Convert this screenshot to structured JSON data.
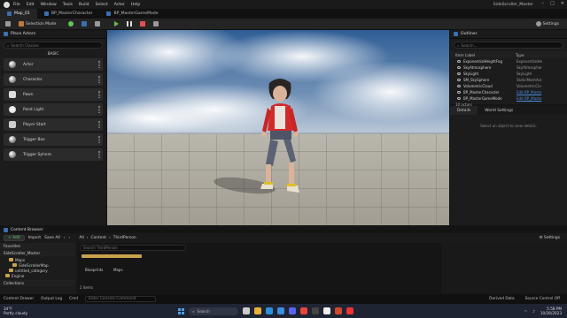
{
  "app": {
    "menu": [
      "File",
      "Edit",
      "Window",
      "Tools",
      "Build",
      "Select",
      "Actor",
      "Help"
    ],
    "project": "SideScroller_Master",
    "map_tab": "Map_01"
  },
  "tabs": [
    "BP_MasterCharacter",
    "BP_MasterGameMode"
  ],
  "toolbar": {
    "save": "",
    "mode": "Selection Mode",
    "settings": "Settings"
  },
  "place_actors": {
    "title": "Place Actors",
    "search_placeholder": "Search Classes",
    "category": "BASIC",
    "items": [
      "Actor",
      "Character",
      "Pawn",
      "Point Light",
      "Player Start",
      "Trigger Box",
      "Trigger Sphere"
    ]
  },
  "outliner": {
    "title": "Outliner",
    "search_placeholder": "Search...",
    "col_label": "Item Label",
    "col_type": "Type",
    "rows": [
      {
        "name": "ExponentialHeightFog",
        "type": "ExponentialHe",
        "link": false
      },
      {
        "name": "SkyAtmosphere",
        "type": "SkyAtmospher",
        "link": false
      },
      {
        "name": "SkyLight",
        "type": "SkyLight",
        "link": false
      },
      {
        "name": "SM_SkySphere",
        "type": "StaticMeshAct",
        "link": false
      },
      {
        "name": "VolumetricCloud",
        "type": "VolumetricClo",
        "link": false
      },
      {
        "name": "BP_MasterCharacter",
        "type": "Edit BP_Maste",
        "link": true
      },
      {
        "name": "BP_MasterGameMode",
        "type": "Edit BP_Maste",
        "link": true
      }
    ],
    "actor_count": "10 actors"
  },
  "details": {
    "tab_details": "Details",
    "tab_world": "World Settings",
    "empty": "Select an object to view details."
  },
  "content_browser": {
    "title": "Content Browser",
    "add": "+ Add",
    "import": "Import",
    "save_all": "Save All",
    "path": [
      "All",
      "Content",
      "ThirdPerson"
    ],
    "settings": "Settings",
    "favorites": "Favorites",
    "root": "SideScroller_Master",
    "tree": [
      "Maps",
      "SideScrollerMap",
      "untitled_category",
      "Engine"
    ],
    "collections": "Collections",
    "search_placeholder": "Search ThirdPerson",
    "assets": [
      "Blueprints",
      "Maps"
    ],
    "items": "2 items"
  },
  "status": {
    "drawer": "Content Drawer",
    "output_log": "Output Log",
    "cmd": "Cmd",
    "cmd_placeholder": "Enter Console Command",
    "derived": "Derived Data",
    "source": "Source Control Off"
  },
  "taskbar": {
    "temp": "34°F",
    "weather": "Partly cloudy",
    "search": "Search",
    "time": "5:58 PM",
    "date": "10/26/2023"
  }
}
